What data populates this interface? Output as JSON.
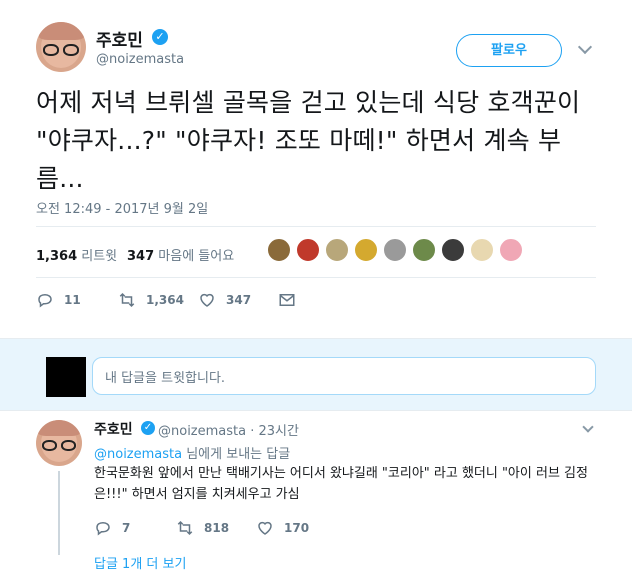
{
  "tweet": {
    "author_name": "주호민",
    "author_handle": "@noizemasta",
    "follow_label": "팔로우",
    "text": "어제 저녁 브뤼셀 골목을 걷고 있는데 식당 호객꾼이 \"야쿠자...?\" \"야쿠자! 조또 마떼!\" 하면서 계속 부름...",
    "timestamp": "오전 12:49 - 2017년 9월 2일",
    "retweets_count": "1,364",
    "retweets_label": "리트윗",
    "likes_count": "347",
    "likes_label": "마음에 들어요",
    "actions": {
      "reply_count": "11",
      "retweet_count": "1,364",
      "like_count": "347"
    }
  },
  "likers": [
    {
      "color": "#8a6a3a"
    },
    {
      "color": "#c0392b"
    },
    {
      "color": "#b8a77a"
    },
    {
      "color": "#d4a92f"
    },
    {
      "color": "#9a9a9a"
    },
    {
      "color": "#6d8a4a"
    },
    {
      "color": "#3b3b3b"
    },
    {
      "color": "#e8d8b0"
    },
    {
      "color": "#f0a7b5"
    }
  ],
  "compose": {
    "placeholder": "내 답글을 트윗합니다."
  },
  "reply": {
    "author_name": "주호민",
    "author_handle": "@noizemasta · 23시간",
    "reply_to_mention": "@noizemasta",
    "reply_to_suffix": " 님에게 보내는 답글",
    "text": "한국문화원 앞에서 만난 택배기사는 어디서 왔냐길래 \"코리아\" 라고 했더니 \"아이 러브 김정은!!!\" 하면서 엄지를 치켜세우고 가심",
    "actions": {
      "reply_count": "7",
      "retweet_count": "818",
      "like_count": "170"
    },
    "more_replies": "답글 1개 더 보기"
  },
  "colors": {
    "accent": "#1da1f2",
    "muted": "#657786",
    "compose_bg": "#e8f5fd"
  },
  "icons": [
    "verified-icon",
    "chevron-down-icon",
    "reply-icon",
    "retweet-icon",
    "like-icon",
    "message-icon"
  ]
}
